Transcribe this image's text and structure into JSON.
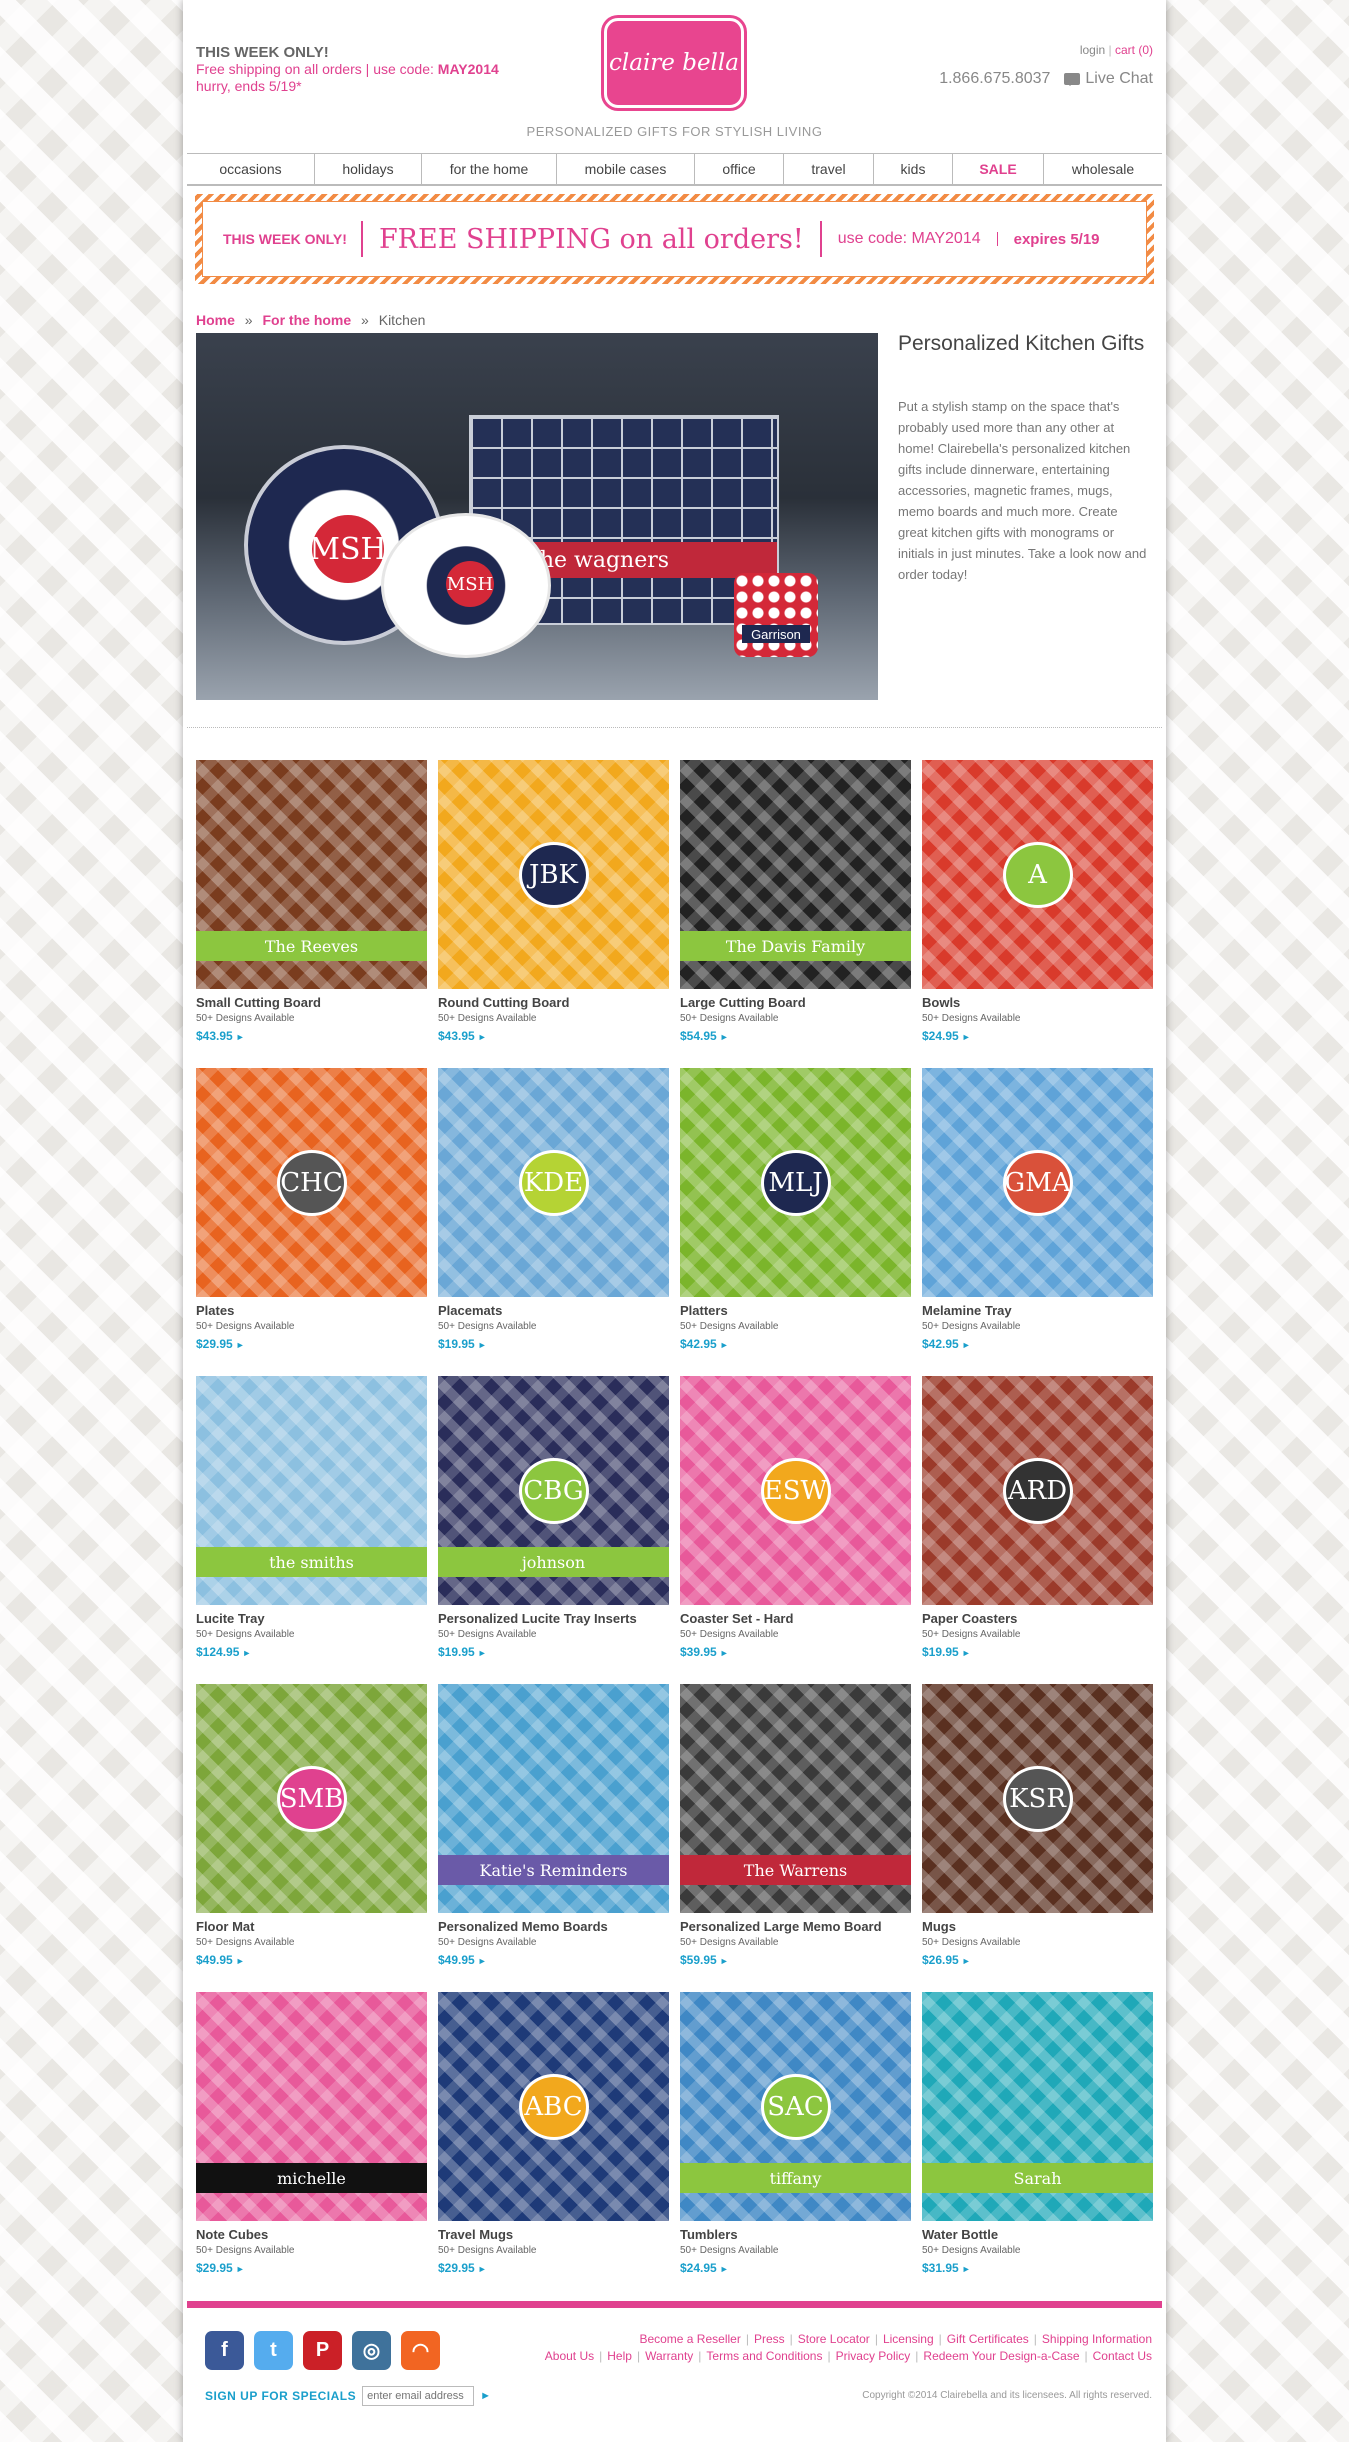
{
  "header": {
    "week_label": "THIS WEEK ONLY!",
    "free_ship": "Free shipping on all orders",
    "use_code_label": "use code:",
    "code": "MAY2014",
    "hurry": "hurry, ends 5/19*",
    "logo_text": "claire bella",
    "tagline": "PERSONALIZED GIFTS FOR STYLISH LIVING",
    "login": "login",
    "cart": "cart (0)",
    "phone": "1.866.675.8037",
    "live_chat": "Live Chat"
  },
  "nav": [
    {
      "label": "occasions"
    },
    {
      "label": "holidays"
    },
    {
      "label": "for the home"
    },
    {
      "label": "mobile cases"
    },
    {
      "label": "office"
    },
    {
      "label": "travel"
    },
    {
      "label": "kids"
    },
    {
      "label": "SALE"
    },
    {
      "label": "wholesale"
    }
  ],
  "banner": {
    "week": "THIS WEEK ONLY!",
    "headline": "FREE SHIPPING on all orders!",
    "code": "use code: MAY2014",
    "expires": "expires 5/19"
  },
  "breadcrumb": {
    "home": "Home",
    "section": "For the home",
    "current": "Kitchen",
    "sep": "»"
  },
  "hero": {
    "title": "Personalized Kitchen Gifts",
    "text": "Put a stylish stamp on the space that's probably used more than any other at home! Clairebella's personalized kitchen gifts include dinnerware, entertaining accessories, magnetic frames, mugs, memo boards and much more. Create great kitchen gifts with monograms or initials in just minutes. Take a look now and order today!",
    "plate_mono": "MSH",
    "bowl_mono": "MSH",
    "board_text": "the wagners",
    "coaster_text": "Garrison"
  },
  "products": [
    {
      "name": "Small Cutting Board",
      "sub": "50+ Designs Available",
      "price": "$43.95",
      "bg": "#7a3c1e",
      "accent": "#8cc63f",
      "mono": ""
    },
    {
      "name": "Round Cutting Board",
      "sub": "50+ Designs Available",
      "price": "$43.95",
      "bg": "#f2a81d",
      "accent": "#1e2850",
      "mono": "JBK"
    },
    {
      "name": "Large Cutting Board",
      "sub": "50+ Designs Available",
      "price": "$54.95",
      "bg": "#222222",
      "accent": "#8cc63f",
      "mono": ""
    },
    {
      "name": "Bowls",
      "sub": "50+ Designs Available",
      "price": "$24.95",
      "bg": "#d93a2b",
      "accent": "#8cc63f",
      "mono": "A"
    },
    {
      "name": "Plates",
      "sub": "50+ Designs Available",
      "price": "$29.95",
      "bg": "#e8631f",
      "accent": "#555555",
      "mono": "CHC"
    },
    {
      "name": "Placemats",
      "sub": "50+ Designs Available",
      "price": "$19.95",
      "bg": "#6aa7d6",
      "accent": "#b5d334",
      "mono": "KDE"
    },
    {
      "name": "Platters",
      "sub": "50+ Designs Available",
      "price": "$42.95",
      "bg": "#7bb52b",
      "accent": "#1e2850",
      "mono": "MLJ"
    },
    {
      "name": "Melamine Tray",
      "sub": "50+ Designs Available",
      "price": "$42.95",
      "bg": "#5fa3d8",
      "accent": "#d9513a",
      "mono": "GMA"
    },
    {
      "name": "Lucite Tray",
      "sub": "50+ Designs Available",
      "price": "$124.95",
      "bg": "#8cc0e0",
      "accent": "#8cc63f",
      "mono": ""
    },
    {
      "name": "Personalized Lucite Tray Inserts",
      "sub": "50+ Designs Available",
      "price": "$19.95",
      "bg": "#2a2d5a",
      "accent": "#8cc63f",
      "mono": "CBG"
    },
    {
      "name": "Coaster Set - Hard",
      "sub": "50+ Designs Available",
      "price": "$39.95",
      "bg": "#e8599a",
      "accent": "#f2a81d",
      "mono": "ESW"
    },
    {
      "name": "Paper Coasters",
      "sub": "50+ Designs Available",
      "price": "$19.95",
      "bg": "#9b3a2a",
      "accent": "#333333",
      "mono": "ARD"
    },
    {
      "name": "Floor Mat",
      "sub": "50+ Designs Available",
      "price": "$49.95",
      "bg": "#7da63a",
      "accent": "#e0418f",
      "mono": "SMB"
    },
    {
      "name": "Personalized Memo Boards",
      "sub": "50+ Designs Available",
      "price": "$49.95",
      "bg": "#4aa0cf",
      "accent": "#6a5aa8",
      "mono": ""
    },
    {
      "name": "Personalized Large Memo Board",
      "sub": "50+ Designs Available",
      "price": "$59.95",
      "bg": "#3a3a3a",
      "accent": "#c0283a",
      "mono": ""
    },
    {
      "name": "Mugs",
      "sub": "50+ Designs Available",
      "price": "$26.95",
      "bg": "#5a3020",
      "accent": "#555555",
      "mono": "KSR"
    },
    {
      "name": "Note Cubes",
      "sub": "50+ Designs Available",
      "price": "$29.95",
      "bg": "#e8599a",
      "accent": "#111111",
      "mono": ""
    },
    {
      "name": "Travel Mugs",
      "sub": "50+ Designs Available",
      "price": "$29.95",
      "bg": "#1e3a78",
      "accent": "#f2a81d",
      "mono": "ABC"
    },
    {
      "name": "Tumblers",
      "sub": "50+ Designs Available",
      "price": "$24.95",
      "bg": "#3f88c5",
      "accent": "#8cc63f",
      "mono": "SAC"
    },
    {
      "name": "Water Bottle",
      "sub": "50+ Designs Available",
      "price": "$31.95",
      "bg": "#1fa8b8",
      "accent": "#8cc63f",
      "mono": ""
    }
  ],
  "product_captions": {
    "0": "The Reeves",
    "2": "The Davis Family",
    "8": "the smiths",
    "9": "johnson",
    "13": "Katie's Reminders",
    "14": "The Warrens",
    "16": "michelle",
    "18": "tiffany",
    "19": "Sarah"
  },
  "footer": {
    "signup_label": "SIGN UP FOR SPECIALS",
    "email_placeholder": "enter email address",
    "go": "►",
    "links_row1": [
      "Become a Reseller",
      "Press",
      "Store Locator",
      "Licensing",
      "Gift Certificates",
      "Shipping Information"
    ],
    "links_row2": [
      "About Us",
      "Help",
      "Warranty",
      "Terms and Conditions",
      "Privacy Policy",
      "Redeem Your Design-a-Case",
      "Contact Us"
    ],
    "copyright": "Copyright ©2014 Clairebella and its licensees. All rights reserved.",
    "socials": [
      {
        "name": "facebook-icon",
        "glyph": "f",
        "color": "#3b5998"
      },
      {
        "name": "twitter-icon",
        "glyph": "t",
        "color": "#55acee"
      },
      {
        "name": "pinterest-icon",
        "glyph": "P",
        "color": "#cb2027"
      },
      {
        "name": "instagram-icon",
        "glyph": "◎",
        "color": "#3f729b"
      },
      {
        "name": "rss-icon",
        "glyph": "◠",
        "color": "#f26522"
      }
    ]
  }
}
